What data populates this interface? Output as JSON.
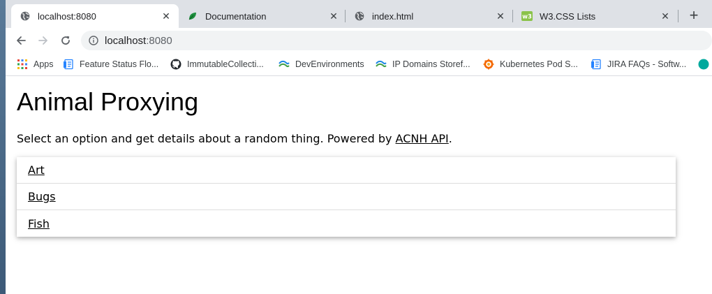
{
  "browser": {
    "tabs": [
      {
        "title": "localhost:8080",
        "icon": "globe-icon",
        "active": true
      },
      {
        "title": "Documentation",
        "icon": "leaf-icon",
        "active": false
      },
      {
        "title": "index.html",
        "icon": "globe-icon",
        "active": false
      },
      {
        "title": "W3.CSS Lists",
        "icon": "w3-icon",
        "active": false
      }
    ],
    "close_glyph": "✕",
    "new_tab_glyph": "+",
    "address": {
      "host": "localhost",
      "port": ":8080"
    },
    "bookmarks": [
      {
        "label": "Apps",
        "icon": "apps-grid-icon"
      },
      {
        "label": "Feature Status Flo...",
        "icon": "confluence-page-icon"
      },
      {
        "label": "ImmutableCollecti...",
        "icon": "github-icon"
      },
      {
        "label": "DevEnvironments",
        "icon": "wave-icon"
      },
      {
        "label": "IP Domains Storef...",
        "icon": "wave-icon"
      },
      {
        "label": "Kubernetes Pod S...",
        "icon": "grafana-icon"
      },
      {
        "label": "JIRA FAQs - Softw...",
        "icon": "confluence-page-icon"
      }
    ]
  },
  "page": {
    "title": "Animal Proxying",
    "intro_prefix": "Select an option and get details about a random thing. Powered by ",
    "intro_link": "ACNH API",
    "intro_suffix": ".",
    "options": [
      "Art",
      "Bugs",
      "Fish"
    ]
  },
  "colors": {
    "tabstrip_bg": "#dee1e6",
    "omnibox_bg": "#f1f3f4",
    "link": "#000000"
  }
}
